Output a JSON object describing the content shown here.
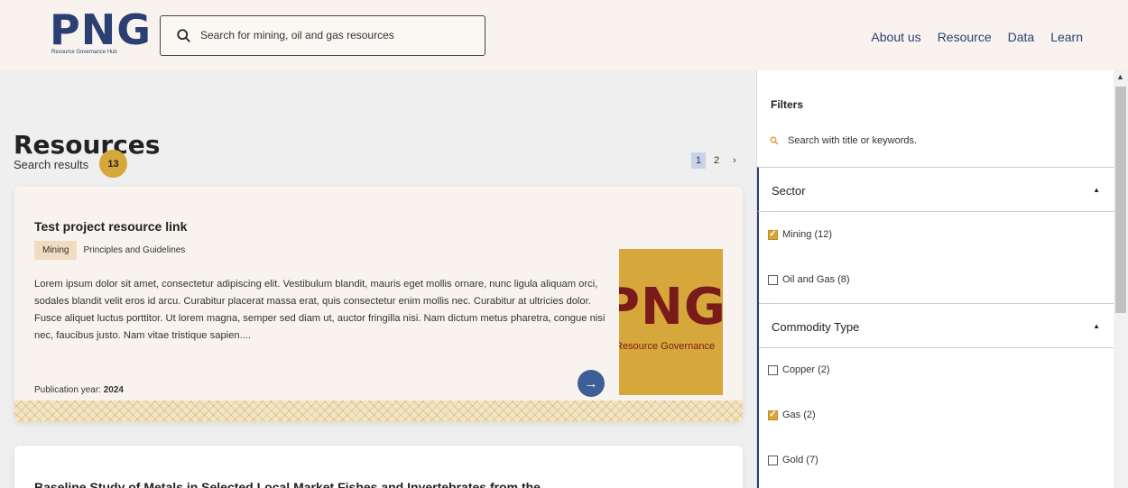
{
  "header": {
    "logo_text": "PNG",
    "logo_subtitle": "Resource Governance Hub",
    "search_placeholder": "Search for mining, oil and gas resources",
    "nav": [
      "About us",
      "Resource",
      "Data",
      "Learn"
    ]
  },
  "main": {
    "title": "Resources",
    "results_label": "Search results",
    "results_count": "13",
    "pagination": [
      "1",
      "2",
      "›"
    ],
    "cards": [
      {
        "title": "Test project resource link",
        "sector_tag": "Mining",
        "type_tag": "Principles and Guidelines",
        "description": "Lorem ipsum dolor sit amet, consectetur adipiscing elit. Vestibulum blandit, mauris eget mollis ornare, nunc ligula aliquam orci, sodales blandit velit eros id arcu. Curabitur placerat massa erat, quis consectetur enim mollis nec. Curabitur at ultricies dolor. Fusce aliquet luctus porttitor. Ut lorem magna, semper sed diam ut, auctor fringilla nisi. Nam dictum metus pharetra, congue nisi nec, faucibus justo. Nam vitae tristique sapien....",
        "pub_label": "Publication year:",
        "pub_year": "2024",
        "image_big": "PNG",
        "image_small": "Resource Governance"
      },
      {
        "title": "Baseline Study of Metals in Selected Local Market Fishes and Invertebrates from the"
      }
    ]
  },
  "sidebar": {
    "title": "Filters",
    "search_placeholder": "Search with title or keywords.",
    "sections": [
      {
        "label": "Sector",
        "options": [
          {
            "label": "Mining (12)",
            "checked": true
          },
          {
            "label": "Oil and Gas (8)",
            "checked": false
          }
        ]
      },
      {
        "label": "Commodity Type",
        "options": [
          {
            "label": "Copper (2)",
            "checked": false
          },
          {
            "label": "Gas (2)",
            "checked": true
          },
          {
            "label": "Gold (7)",
            "checked": false
          }
        ]
      }
    ]
  },
  "colors": {
    "brand_blue": "#2b3f73",
    "accent_gold": "#d6a73a",
    "header_bg": "#f8f3ee"
  }
}
